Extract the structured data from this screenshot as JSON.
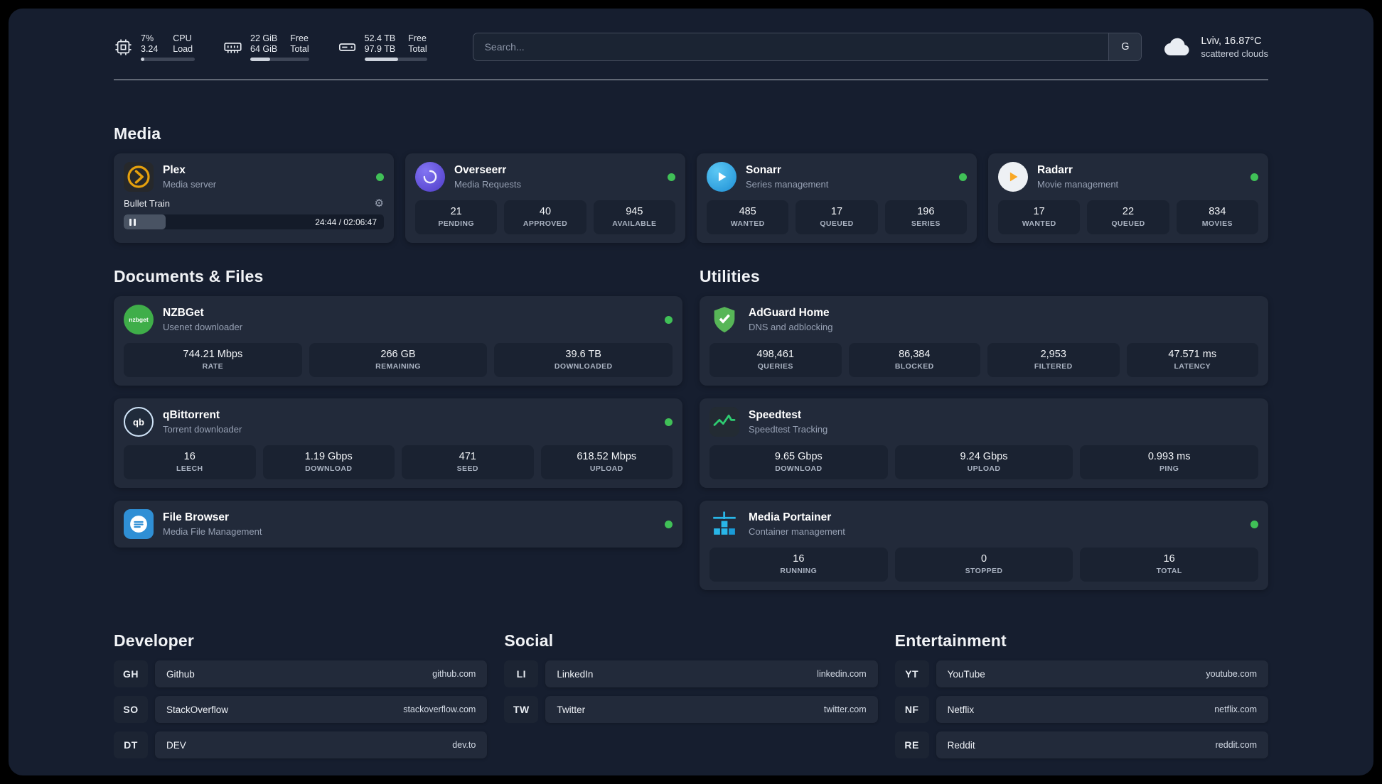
{
  "theme": {
    "board": "#161e2f",
    "card": "#222a3a",
    "tile": "#1a2231",
    "green": "#40c057"
  },
  "topbar": {
    "cpu": {
      "value1": "7%",
      "label1": "CPU",
      "value2": "3.24",
      "label2": "Load",
      "fill": 7
    },
    "ram": {
      "value1": "22 GiB",
      "label1": "Free",
      "value2": "64 GiB",
      "label2": "Total",
      "fill": 34
    },
    "disk": {
      "value1": "52.4 TB",
      "label1": "Free",
      "value2": "97.9 TB",
      "label2": "Total",
      "fill": 54
    },
    "search": {
      "placeholder": "Search...",
      "engine_label": "G"
    },
    "weather": {
      "location": "Lviv, 16.87°C",
      "condition": "scattered clouds"
    }
  },
  "media": {
    "title": "Media",
    "plex": {
      "name": "Plex",
      "subtitle": "Media server",
      "track": "Bullet Train",
      "time": "24:44 / 02:06:47",
      "progress": 16
    },
    "overseerr": {
      "name": "Overseerr",
      "subtitle": "Media Requests",
      "stats": [
        {
          "value": "21",
          "label": "PENDING"
        },
        {
          "value": "40",
          "label": "APPROVED"
        },
        {
          "value": "945",
          "label": "AVAILABLE"
        }
      ]
    },
    "sonarr": {
      "name": "Sonarr",
      "subtitle": "Series management",
      "stats": [
        {
          "value": "485",
          "label": "WANTED"
        },
        {
          "value": "17",
          "label": "QUEUED"
        },
        {
          "value": "196",
          "label": "SERIES"
        }
      ]
    },
    "radarr": {
      "name": "Radarr",
      "subtitle": "Movie management",
      "stats": [
        {
          "value": "17",
          "label": "WANTED"
        },
        {
          "value": "22",
          "label": "QUEUED"
        },
        {
          "value": "834",
          "label": "MOVIES"
        }
      ]
    }
  },
  "documents": {
    "title": "Documents & Files",
    "nzbget": {
      "name": "NZBGet",
      "subtitle": "Usenet downloader",
      "icon_text": "nzbget",
      "stats": [
        {
          "value": "744.21 Mbps",
          "label": "RATE"
        },
        {
          "value": "266 GB",
          "label": "REMAINING"
        },
        {
          "value": "39.6 TB",
          "label": "DOWNLOADED"
        }
      ]
    },
    "qbittorrent": {
      "name": "qBittorrent",
      "subtitle": "Torrent downloader",
      "icon_text": "qb",
      "stats": [
        {
          "value": "16",
          "label": "LEECH"
        },
        {
          "value": "1.19 Gbps",
          "label": "DOWNLOAD"
        },
        {
          "value": "471",
          "label": "SEED"
        },
        {
          "value": "618.52 Mbps",
          "label": "UPLOAD"
        }
      ]
    },
    "filebrowser": {
      "name": "File Browser",
      "subtitle": "Media File Management"
    }
  },
  "utilities": {
    "title": "Utilities",
    "adguard": {
      "name": "AdGuard Home",
      "subtitle": "DNS and adblocking",
      "stats": [
        {
          "value": "498,461",
          "label": "QUERIES"
        },
        {
          "value": "86,384",
          "label": "BLOCKED"
        },
        {
          "value": "2,953",
          "label": "FILTERED"
        },
        {
          "value": "47.571 ms",
          "label": "LATENCY"
        }
      ]
    },
    "speedtest": {
      "name": "Speedtest",
      "subtitle": "Speedtest Tracking",
      "stats": [
        {
          "value": "9.65 Gbps",
          "label": "DOWNLOAD"
        },
        {
          "value": "9.24 Gbps",
          "label": "UPLOAD"
        },
        {
          "value": "0.993 ms",
          "label": "PING"
        }
      ]
    },
    "portainer": {
      "name": "Media Portainer",
      "subtitle": "Container management",
      "stats": [
        {
          "value": "16",
          "label": "RUNNING"
        },
        {
          "value": "0",
          "label": "STOPPED"
        },
        {
          "value": "16",
          "label": "TOTAL"
        }
      ]
    }
  },
  "bookmarks": {
    "developer": {
      "title": "Developer",
      "items": [
        {
          "abbr": "GH",
          "name": "Github",
          "url": "github.com"
        },
        {
          "abbr": "SO",
          "name": "StackOverflow",
          "url": "stackoverflow.com"
        },
        {
          "abbr": "DT",
          "name": "DEV",
          "url": "dev.to"
        }
      ]
    },
    "social": {
      "title": "Social",
      "items": [
        {
          "abbr": "LI",
          "name": "LinkedIn",
          "url": "linkedin.com"
        },
        {
          "abbr": "TW",
          "name": "Twitter",
          "url": "twitter.com"
        }
      ]
    },
    "entertainment": {
      "title": "Entertainment",
      "items": [
        {
          "abbr": "YT",
          "name": "YouTube",
          "url": "youtube.com"
        },
        {
          "abbr": "NF",
          "name": "Netflix",
          "url": "netflix.com"
        },
        {
          "abbr": "RE",
          "name": "Reddit",
          "url": "reddit.com"
        }
      ]
    }
  }
}
